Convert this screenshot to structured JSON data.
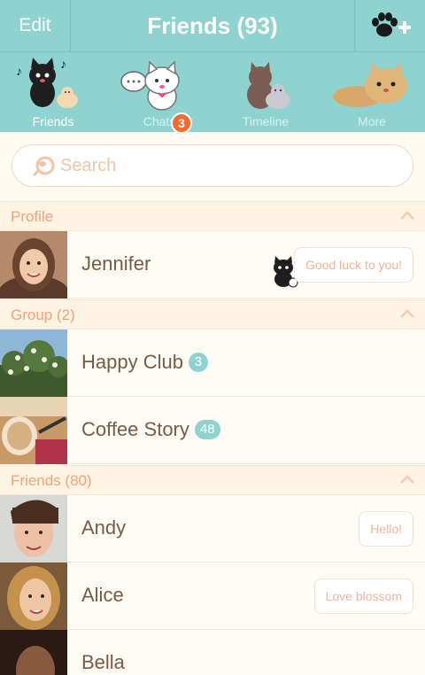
{
  "header": {
    "edit_label": "Edit",
    "title": "Friends (93)",
    "add_icon": "paw-plus-icon"
  },
  "tabs": [
    {
      "label": "Friends",
      "icon": "black-cat-icon",
      "active": true
    },
    {
      "label": "Chats",
      "icon": "white-cat-icon",
      "badge": "3"
    },
    {
      "label": "Timeline",
      "icon": "cat-timeline-icon"
    },
    {
      "label": "More",
      "icon": "fluffy-cat-icon"
    }
  ],
  "search": {
    "placeholder": "Search",
    "icon": "search-icon"
  },
  "sections": {
    "profile": {
      "title": "Profile"
    },
    "group": {
      "title": "Group (2)"
    },
    "friends": {
      "title": "Friends (80)"
    }
  },
  "profile": {
    "name": "Jennifer",
    "status": "Good luck to you!"
  },
  "groups": [
    {
      "name": "Happy Club",
      "count": "3"
    },
    {
      "name": "Coffee Story",
      "count": "48"
    }
  ],
  "friends": [
    {
      "name": "Andy",
      "status": "Hello!"
    },
    {
      "name": "Alice",
      "status": "Love blossom"
    },
    {
      "name": "Bella",
      "status": ""
    }
  ],
  "colors": {
    "accent": "#8fd3d0",
    "badge": "#f26a2e",
    "section_text": "#f0a27a",
    "name_text": "#7a5a45"
  }
}
